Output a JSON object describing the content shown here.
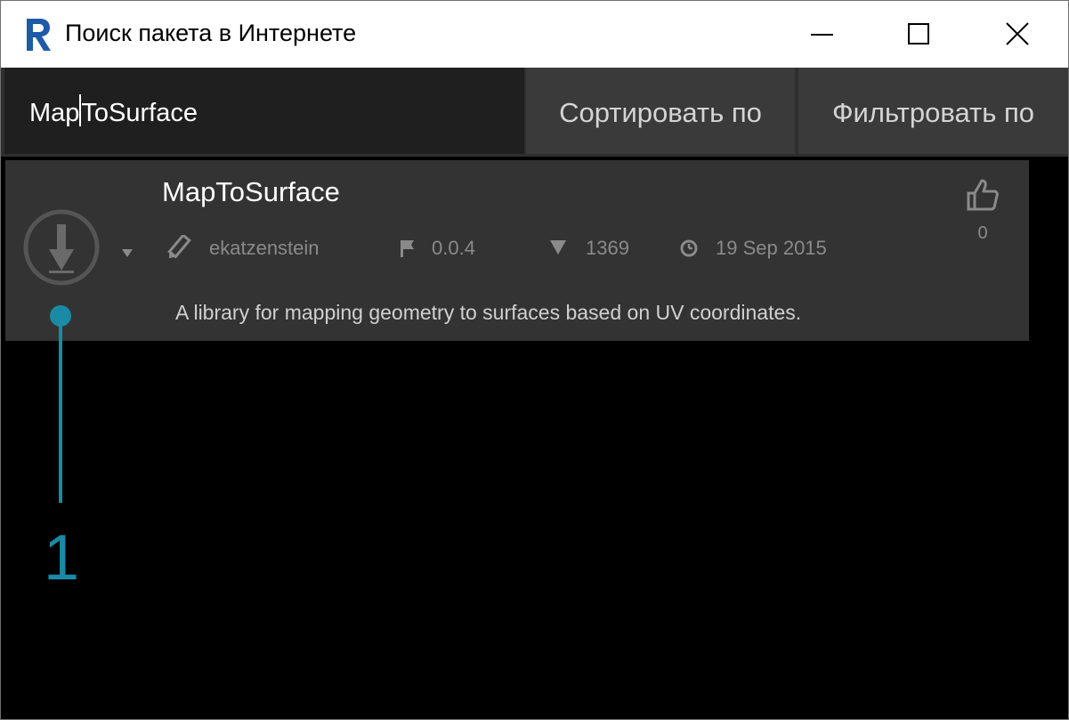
{
  "window": {
    "title": "Поиск пакета в Интернете",
    "logo_letter": "R"
  },
  "toolbar": {
    "search_value": "MapToSurface",
    "sort_label": "Сортировать по",
    "filter_label": "Фильтровать по"
  },
  "package": {
    "name": "MapToSurface",
    "author": "ekatzenstein",
    "version": "0.0.4",
    "downloads": "1369",
    "date": "19 Sep 2015",
    "description": "A library for mapping geometry to surfaces based on UV coordinates.",
    "likes": "0"
  },
  "annotation": {
    "number": "1"
  },
  "colors": {
    "accent": "#1a8aa6",
    "card": "#333333",
    "toolbar": "#2f2f2f",
    "background": "#000000"
  },
  "icons": {
    "install": "download-circle-icon",
    "author": "pencil-icon",
    "version": "flag-icon",
    "downloads": "triangle-down-icon",
    "date": "clock-icon",
    "likes": "thumbs-up-icon"
  }
}
